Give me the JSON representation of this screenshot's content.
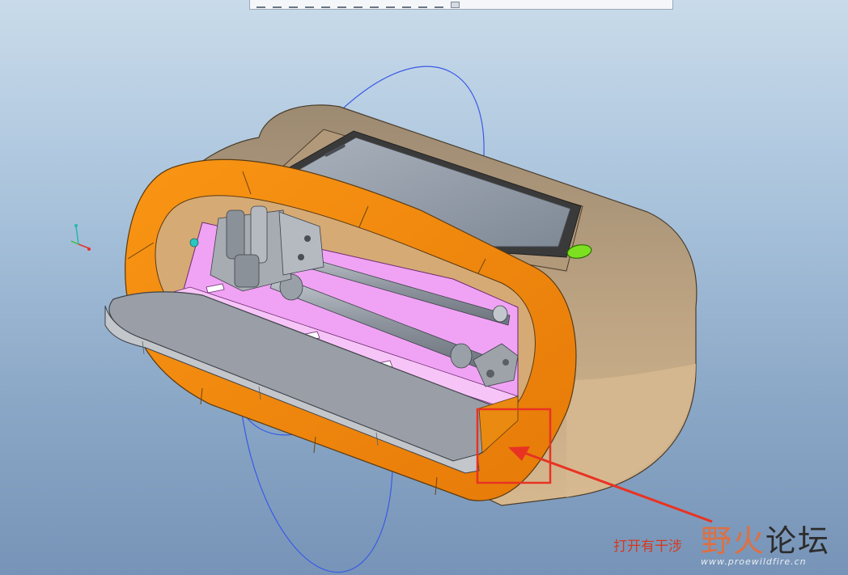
{
  "toolbar": {
    "icons": [
      "zoom-in-icon",
      "zoom-out-icon",
      "refit-icon",
      "repaint-icon",
      "shading-icon",
      "view-manager-icon",
      "saved-views-icon",
      "datum-plane-icon",
      "datum-axis-icon",
      "datum-point-icon",
      "csys-icon",
      "annotation-icon",
      "selected-display-icon"
    ]
  },
  "viewport": {
    "background_top": "#c9dbea",
    "background_bottom": "#7794b8",
    "shell_color": "#d2b48c",
    "rim_color": "#f68b10",
    "inner_color": "#ee9cf0",
    "highlight_color": "#e83323"
  },
  "annotation": {
    "caption": "打开有干涉"
  },
  "watermark": {
    "logo_wild": "野火",
    "logo_forum": "论坛",
    "url": "www.proewildfire.cn"
  }
}
